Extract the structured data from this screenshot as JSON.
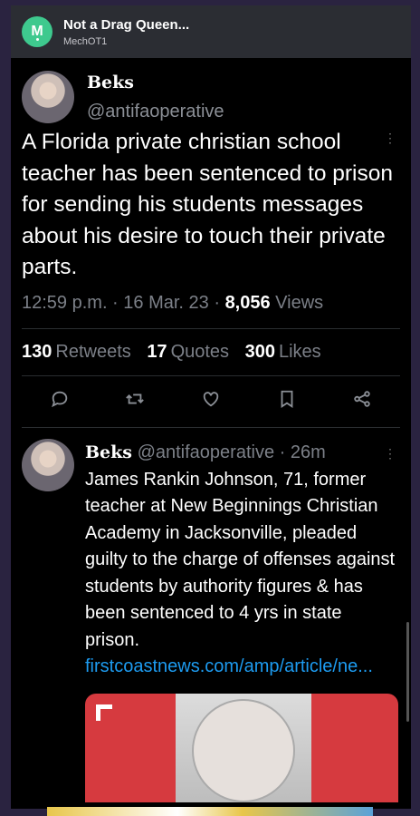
{
  "header": {
    "app_icon_letter": "M",
    "title": "Not a Drag Queen...",
    "subtitle": "MechOT1"
  },
  "tweet": {
    "display_name": "Beks",
    "handle": "@antifaoperative",
    "text": "A Florida private christian school teacher has been sentenced to prison for sending his students messages about his desire to touch their private parts.",
    "time": "12:59 p.m. · 16 Mar. 23 · ",
    "views_count": "8,056",
    "views_label": " Views",
    "retweets_count": "130",
    "retweets_label": "Retweets",
    "quotes_count": "17",
    "quotes_label": "Quotes",
    "likes_count": "300",
    "likes_label": "Likes"
  },
  "reply": {
    "display_name": "Beks",
    "handle_time": " @antifaoperative · 26m",
    "text": "James Rankin Johnson, 71, former teacher at New Beginnings Christian Academy in Jacksonville, pleaded guilty to the charge of offenses against students by authority figures & has been sentenced to 4 yrs in state prison.",
    "link": "firstcoastnews.com/amp/article/ne..."
  },
  "colors": {
    "accent_link": "#1d9bf0",
    "app_icon": "#3ec98e",
    "background": "#000000"
  },
  "icons": [
    "more-icon",
    "reply-icon",
    "retweet-icon",
    "like-icon",
    "bookmark-icon",
    "share-icon"
  ]
}
